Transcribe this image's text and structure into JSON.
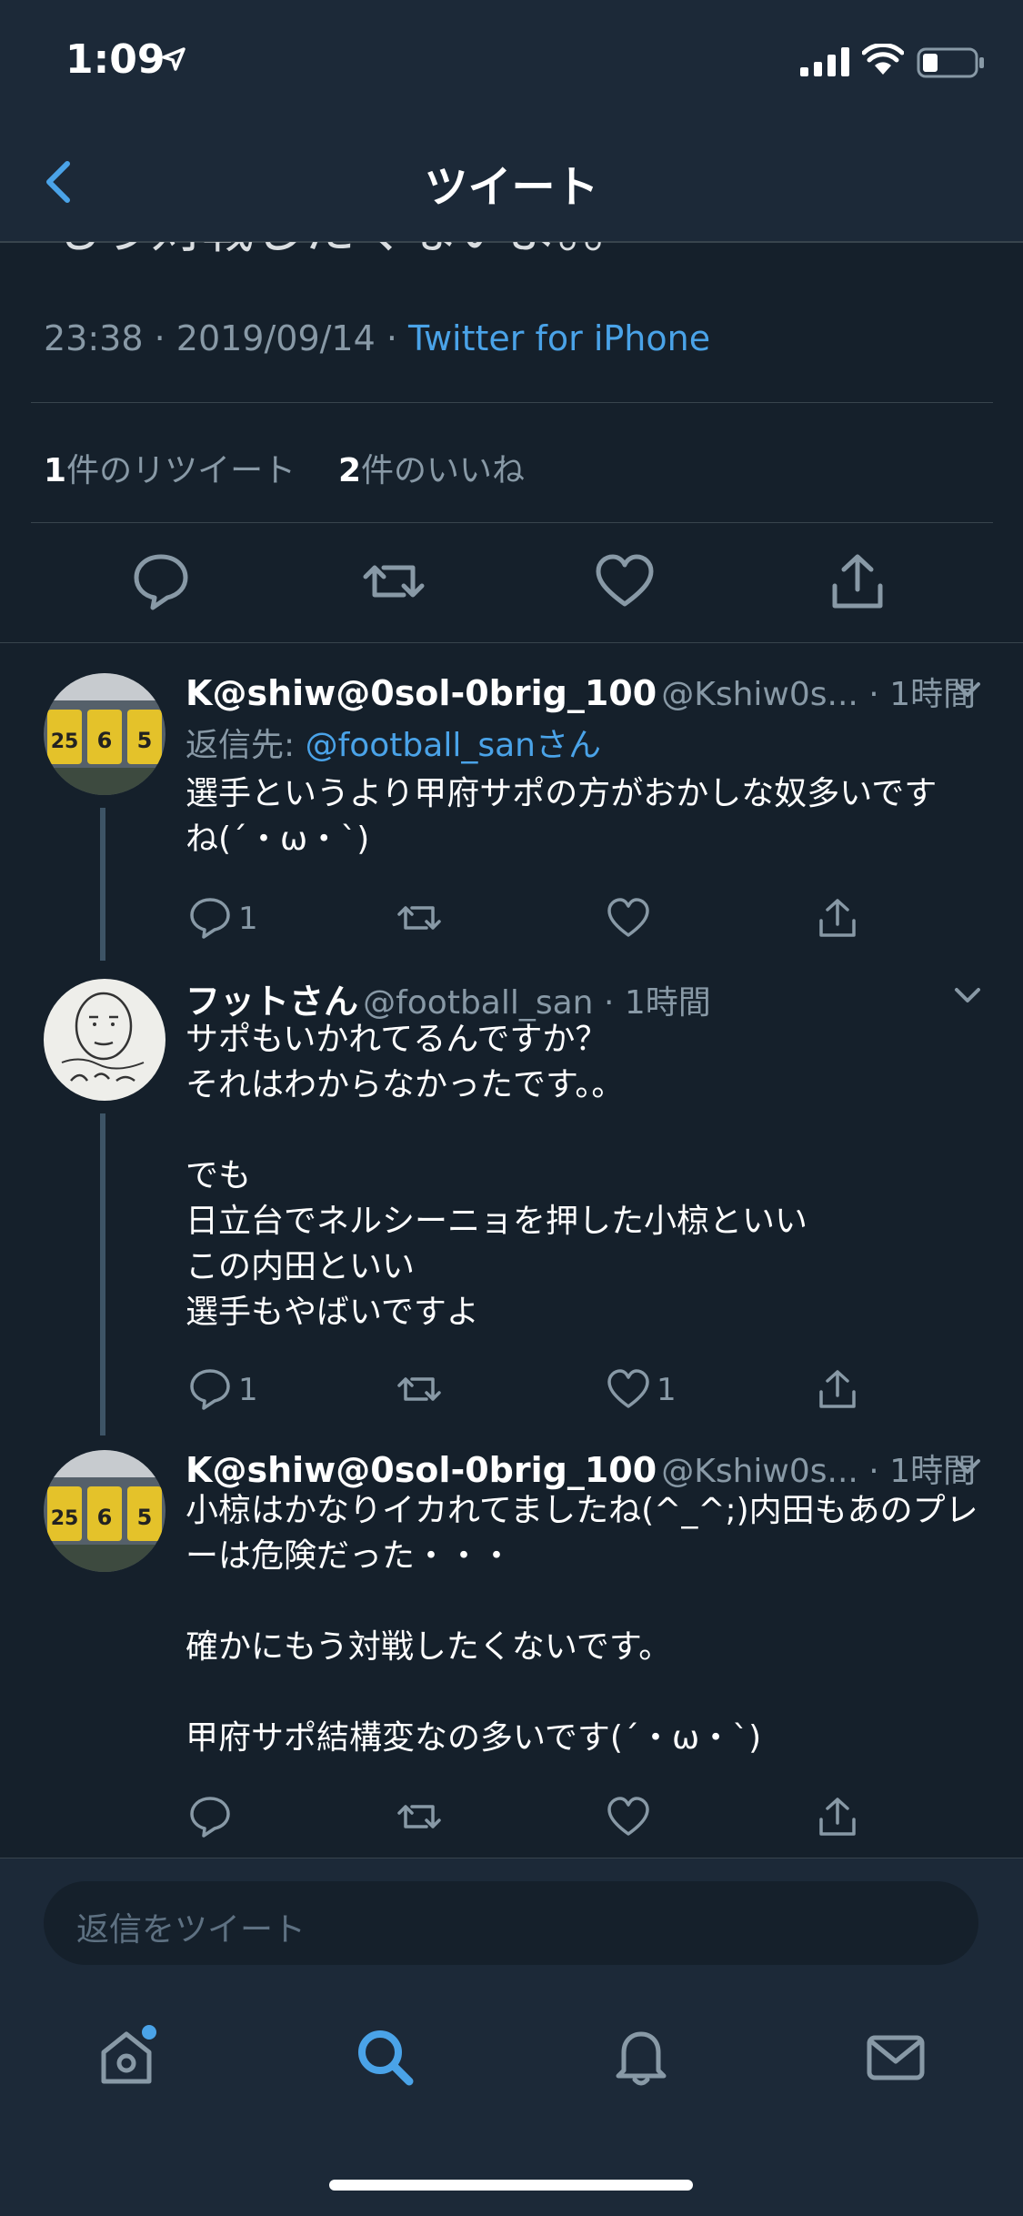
{
  "status_bar": {
    "time": "1:09"
  },
  "nav": {
    "title": "ツイート"
  },
  "main_tweet": {
    "text_tail": "もう対戦したくないよ。。",
    "time": "23:38",
    "date": "2019/09/14",
    "source": "Twitter for iPhone",
    "retweet_count": "1",
    "retweet_label": "件のリツイート",
    "like_count": "2",
    "like_label": "件のいいね"
  },
  "replies": [
    {
      "name": "K@shiw@0sol-0brig_100",
      "handle": "@Kshiw0s...",
      "time": "1時間",
      "reply_to_label": "返信先: ",
      "reply_to_mention": "@football_sanさん",
      "text": "選手というより甲府サポの方がおかしな奴多いです\nね(´・ω・`)",
      "reply_count": "1",
      "like_count": ""
    },
    {
      "name": "フットさん",
      "handle": "@football_san",
      "time": "1時間",
      "text": "サポもいかれてるんですか？\nそれはわからなかったです。。\n\nでも\n日立台でネルシーニョを押した小椋といい\nこの内田といい\n選手もやばいですよ",
      "reply_count": "1",
      "like_count": "1"
    },
    {
      "name": "K@shiw@0sol-0brig_100",
      "handle": "@Kshiw0s...",
      "time": "1時間",
      "text": "小椋はかなりイカれてましたね(^_^;)内田もあのプレ\nーは危険だった・・・\n\n確かにもう対戦したくないです。\n\n甲府サポ結構変なの多いです(´・ω・`)",
      "reply_count": "",
      "like_count": ""
    }
  ],
  "compose": {
    "placeholder": "返信をツイート"
  },
  "colors": {
    "accent": "#4aa3e8",
    "background": "#15202b",
    "bar": "#1c2938",
    "secondary_text": "#8899a6"
  },
  "icons": [
    "reply-icon",
    "retweet-icon",
    "like-icon",
    "share-icon",
    "chevron-down-icon",
    "home-icon",
    "search-icon",
    "notifications-icon",
    "messages-icon"
  ]
}
